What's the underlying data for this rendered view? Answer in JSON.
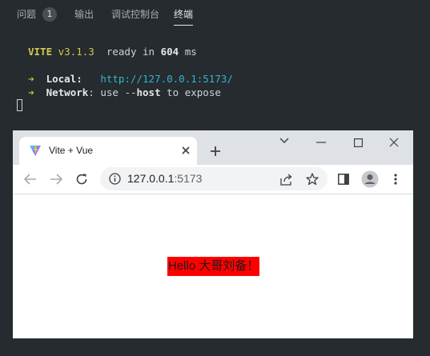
{
  "panel": {
    "tabs": [
      {
        "label": "问题"
      },
      {
        "label": "输出"
      },
      {
        "label": "调试控制台"
      },
      {
        "label": "终端"
      }
    ],
    "problems_count": "1"
  },
  "terminal": {
    "vite_name": "VITE",
    "vite_version": "v3.1.3",
    "ready_prefix": "ready in",
    "ready_ms": "604",
    "ready_unit": "ms",
    "arrow": "➜",
    "local_label": "Local",
    "local_url": "http://127.0.0.1:5173/",
    "network_label": "Network",
    "network_text_1": "use --",
    "network_host": "host",
    "network_text_2": "to expose"
  },
  "browser": {
    "tab_title": "Vite + Vue",
    "url_host": "127.0.0.1",
    "url_port": ":5173",
    "page_text": "Hello 大哥刘备！",
    "icons": [
      "vite-logo-icon",
      "close-tab-icon",
      "new-tab-icon",
      "chevron-down-icon",
      "minimize-icon",
      "maximize-icon",
      "window-close-icon",
      "back-arrow-icon",
      "forward-arrow-icon",
      "reload-icon",
      "info-icon",
      "share-icon",
      "star-icon",
      "side-panel-icon",
      "profile-icon",
      "menu-kebab-icon"
    ],
    "colors": {
      "highlight": "#ff0000",
      "link": "#36b3cc",
      "vite_yellow": "#d2c94e"
    }
  }
}
